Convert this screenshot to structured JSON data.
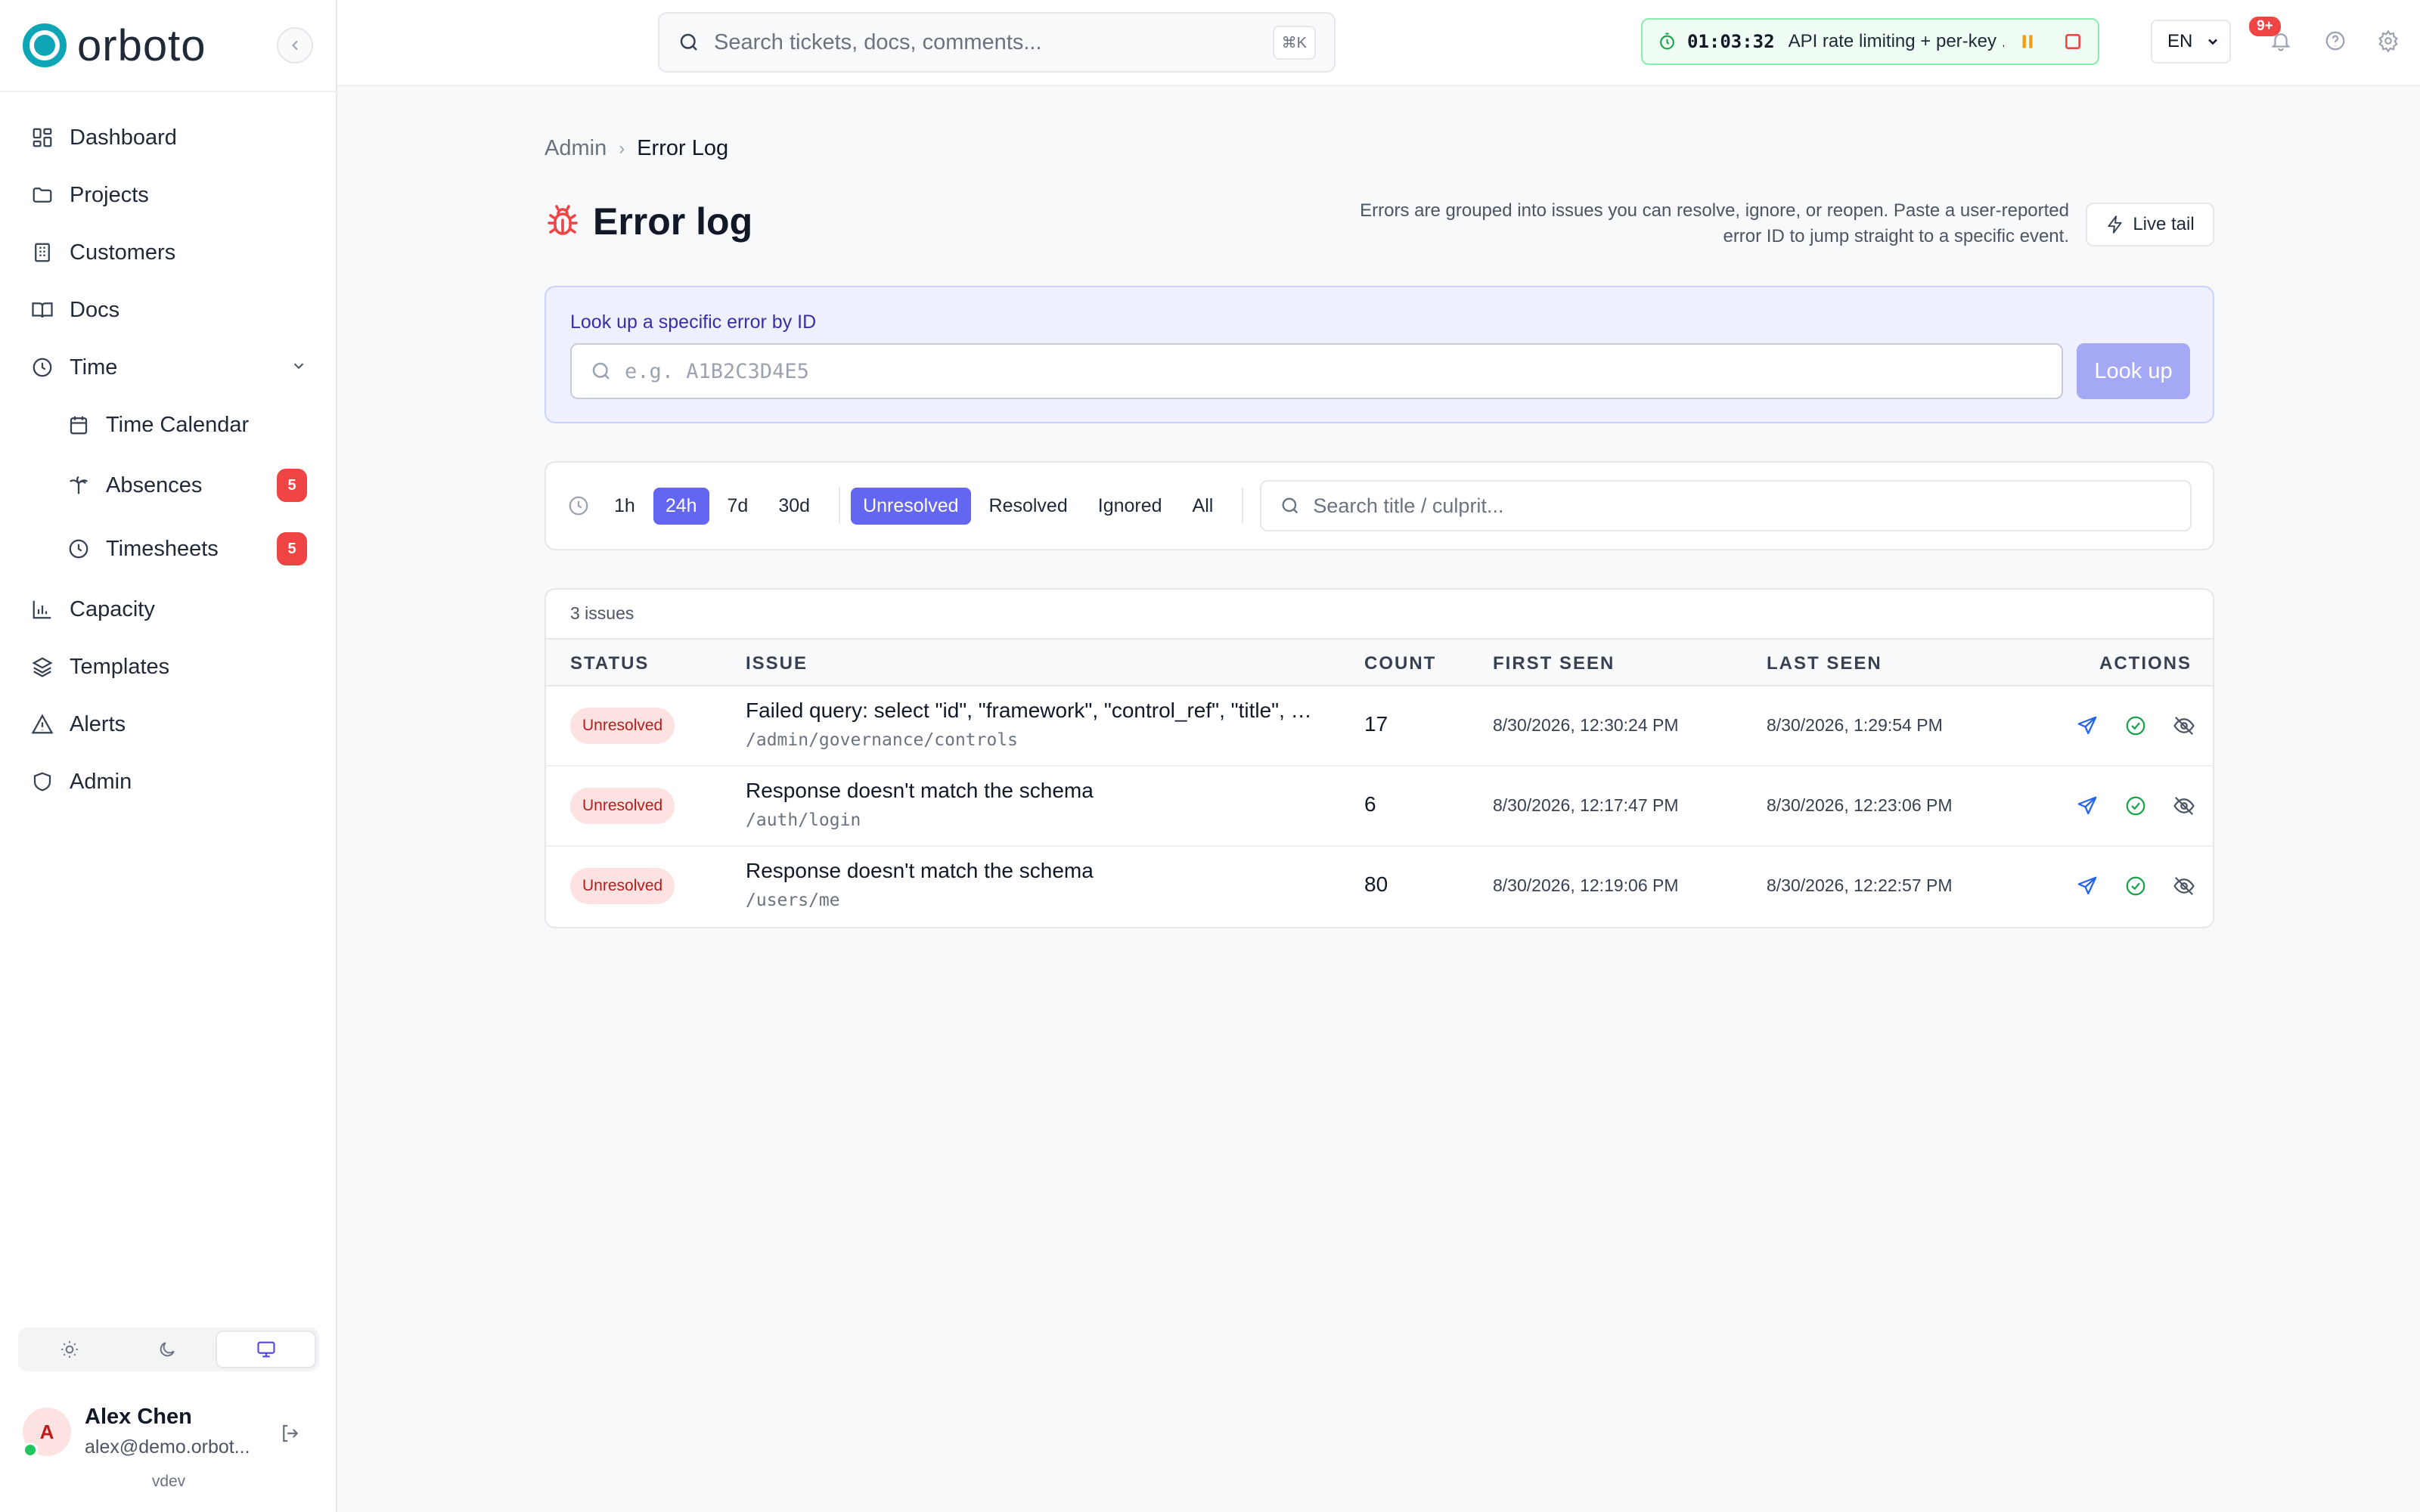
{
  "brand": {
    "name": "orboto"
  },
  "sidebar": {
    "items": [
      {
        "label": "Dashboard",
        "icon": "dashboard-icon"
      },
      {
        "label": "Projects",
        "icon": "folder-icon"
      },
      {
        "label": "Customers",
        "icon": "building-icon"
      },
      {
        "label": "Docs",
        "icon": "book-icon"
      },
      {
        "label": "Time",
        "icon": "clock-icon"
      },
      {
        "label": "Time Calendar",
        "icon": "calendar-icon"
      },
      {
        "label": "Absences",
        "icon": "palm-tree-icon",
        "badge": "5"
      },
      {
        "label": "Timesheets",
        "icon": "clock-icon",
        "badge": "5"
      },
      {
        "label": "Capacity",
        "icon": "bar-chart-icon"
      },
      {
        "label": "Templates",
        "icon": "layers-icon"
      },
      {
        "label": "Alerts",
        "icon": "alert-triangle-icon"
      },
      {
        "label": "Admin",
        "icon": "shield-icon"
      }
    ],
    "theme_options": [
      "light",
      "dark",
      "system"
    ],
    "theme_selected": "system",
    "user": {
      "initial": "A",
      "name": "Alex Chen",
      "email": "alex@demo.orbot..."
    },
    "version": "vdev"
  },
  "topbar": {
    "search_placeholder": "Search tickets, docs, comments...",
    "search_shortcut": "⌘K",
    "timer": {
      "time": "01:03:32",
      "task": "API rate limiting + per-key ..."
    },
    "language": "EN",
    "notifications_badge": "9+"
  },
  "breadcrumb": {
    "parent": "Admin",
    "current": "Error Log"
  },
  "page": {
    "title": "Error log",
    "description": "Errors are grouped into issues you can resolve, ignore, or reopen. Paste a user-reported error ID to jump straight to a specific event.",
    "live_tail_label": "Live tail"
  },
  "lookup": {
    "label": "Look up a specific error by ID",
    "placeholder": "e.g. A1B2C3D4E5",
    "button_label": "Look up"
  },
  "filters": {
    "time_ranges": [
      "1h",
      "24h",
      "7d",
      "30d"
    ],
    "time_selected": "24h",
    "statuses": [
      "Unresolved",
      "Resolved",
      "Ignored",
      "All"
    ],
    "status_selected": "Unresolved",
    "search_placeholder": "Search title / culprit..."
  },
  "table": {
    "summary": "3 issues",
    "columns": [
      "STATUS",
      "ISSUE",
      "COUNT",
      "FIRST SEEN",
      "LAST SEEN",
      "ACTIONS"
    ],
    "rows": [
      {
        "status": "Unresolved",
        "title": "Failed query: select \"id\", \"framework\", \"control_ref\", \"title\", \"description\"",
        "path": "/admin/governance/controls",
        "count": "17",
        "first_seen": "8/30/2026, 12:30:24 PM",
        "last_seen": "8/30/2026, 1:29:54 PM"
      },
      {
        "status": "Unresolved",
        "title": "Response doesn't match the schema",
        "path": "/auth/login",
        "count": "6",
        "first_seen": "8/30/2026, 12:17:47 PM",
        "last_seen": "8/30/2026, 12:23:06 PM"
      },
      {
        "status": "Unresolved",
        "title": "Response doesn't match the schema",
        "path": "/users/me",
        "count": "80",
        "first_seen": "8/30/2026, 12:19:06 PM",
        "last_seen": "8/30/2026, 12:22:57 PM"
      }
    ]
  },
  "colors": {
    "accent": "#6366f1",
    "brand": "#0ea5b7",
    "danger": "#ef4444",
    "success": "#16a34a",
    "link": "#2563eb"
  }
}
